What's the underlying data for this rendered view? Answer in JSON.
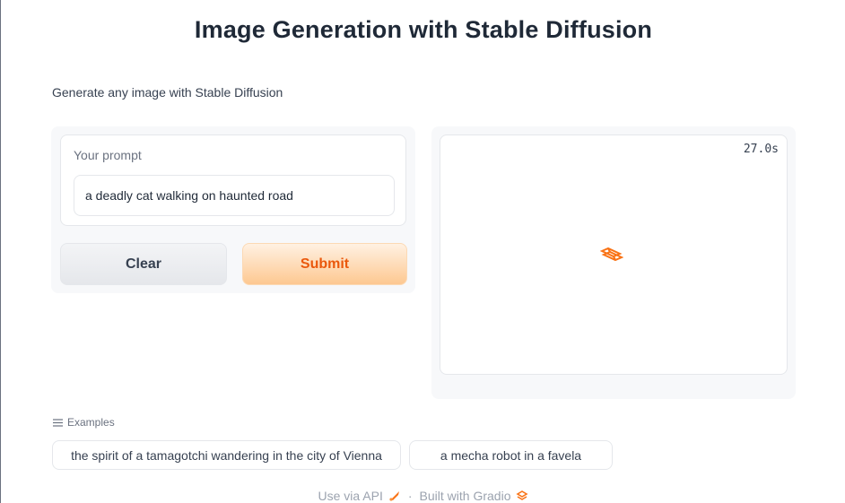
{
  "header": {
    "title": "Image Generation with Stable Diffusion"
  },
  "description": "Generate any image with Stable Diffusion",
  "prompt": {
    "label": "Your prompt",
    "value": "a deadly cat walking on haunted road"
  },
  "buttons": {
    "clear": "Clear",
    "submit": "Submit"
  },
  "output": {
    "timer": "27.0s",
    "loading_icon": "gradio-loading-icon"
  },
  "examples": {
    "label": "Examples",
    "items": [
      "the spirit of a tamagotchi wandering in the city of Vienna",
      "a mecha robot in a favela"
    ]
  },
  "footer": {
    "api_link": "Use via API",
    "separator": "·",
    "built_with": "Built with Gradio"
  },
  "colors": {
    "accent": "#ea580c",
    "submit_bg": "#fdc891",
    "panel_bg": "#f7f8fa"
  }
}
